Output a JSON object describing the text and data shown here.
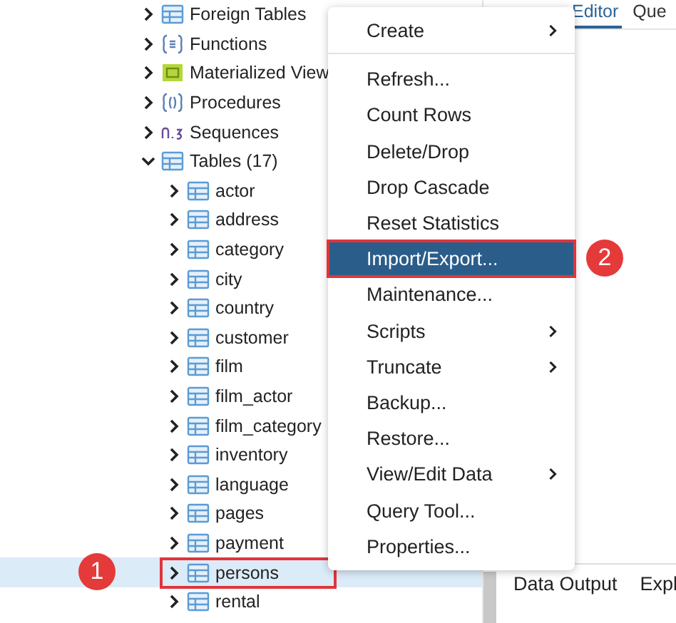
{
  "tree": [
    {
      "label": "Foreign Tables",
      "kind": "foreign-table",
      "expanded": false
    },
    {
      "label": "Functions",
      "kind": "function",
      "expanded": false
    },
    {
      "label": "Materialized View",
      "kind": "materialized-view",
      "expanded": false
    },
    {
      "label": "Procedures",
      "kind": "procedure",
      "expanded": false
    },
    {
      "label": "Sequences",
      "kind": "sequence",
      "expanded": false
    },
    {
      "label": "Tables (17)",
      "kind": "table",
      "expanded": true,
      "children": [
        {
          "label": "actor",
          "kind": "table",
          "expanded": false,
          "selected": false,
          "outlined": false
        },
        {
          "label": "address",
          "kind": "table",
          "expanded": false,
          "selected": false,
          "outlined": false
        },
        {
          "label": "category",
          "kind": "table",
          "expanded": false,
          "selected": false,
          "outlined": false
        },
        {
          "label": "city",
          "kind": "table",
          "expanded": false,
          "selected": false,
          "outlined": false
        },
        {
          "label": "country",
          "kind": "table",
          "expanded": false,
          "selected": false,
          "outlined": false
        },
        {
          "label": "customer",
          "kind": "table",
          "expanded": false,
          "selected": false,
          "outlined": false
        },
        {
          "label": "film",
          "kind": "table",
          "expanded": false,
          "selected": false,
          "outlined": false
        },
        {
          "label": "film_actor",
          "kind": "table",
          "expanded": false,
          "selected": false,
          "outlined": false
        },
        {
          "label": "film_category",
          "kind": "table",
          "expanded": false,
          "selected": false,
          "outlined": false
        },
        {
          "label": "inventory",
          "kind": "table",
          "expanded": false,
          "selected": false,
          "outlined": false
        },
        {
          "label": "language",
          "kind": "table",
          "expanded": false,
          "selected": false,
          "outlined": false
        },
        {
          "label": "pages",
          "kind": "table",
          "expanded": false,
          "selected": false,
          "outlined": false
        },
        {
          "label": "payment",
          "kind": "table",
          "expanded": false,
          "selected": false,
          "outlined": false
        },
        {
          "label": "persons",
          "kind": "table",
          "expanded": false,
          "selected": true,
          "outlined": true,
          "callout": "1"
        },
        {
          "label": "rental",
          "kind": "table",
          "expanded": false,
          "selected": false,
          "outlined": false
        }
      ]
    }
  ],
  "context_menu": [
    {
      "label": "Create",
      "submenu": true,
      "selected": false,
      "outlined": false,
      "divider_after": true
    },
    {
      "label": "Refresh...",
      "submenu": false,
      "selected": false,
      "outlined": false
    },
    {
      "label": "Count Rows",
      "submenu": false,
      "selected": false,
      "outlined": false
    },
    {
      "label": "Delete/Drop",
      "submenu": false,
      "selected": false,
      "outlined": false
    },
    {
      "label": "Drop Cascade",
      "submenu": false,
      "selected": false,
      "outlined": false
    },
    {
      "label": "Reset Statistics",
      "submenu": false,
      "selected": false,
      "outlined": false
    },
    {
      "label": "Import/Export...",
      "submenu": false,
      "selected": true,
      "outlined": true,
      "callout": "2"
    },
    {
      "label": "Maintenance...",
      "submenu": false,
      "selected": false,
      "outlined": false
    },
    {
      "label": "Scripts",
      "submenu": true,
      "selected": false,
      "outlined": false
    },
    {
      "label": "Truncate",
      "submenu": true,
      "selected": false,
      "outlined": false
    },
    {
      "label": "Backup...",
      "submenu": false,
      "selected": false,
      "outlined": false
    },
    {
      "label": "Restore...",
      "submenu": false,
      "selected": false,
      "outlined": false
    },
    {
      "label": "View/Edit Data",
      "submenu": true,
      "selected": false,
      "outlined": false
    },
    {
      "label": "Query Tool...",
      "submenu": false,
      "selected": false,
      "outlined": false
    },
    {
      "label": "Properties...",
      "submenu": false,
      "selected": false,
      "outlined": false
    }
  ],
  "editor_tabs": [
    {
      "label": "Editor",
      "selected": true
    },
    {
      "label": "Que",
      "selected": false
    }
  ],
  "output_tabs": [
    {
      "label": "Data Output"
    },
    {
      "label": "Expl"
    }
  ]
}
